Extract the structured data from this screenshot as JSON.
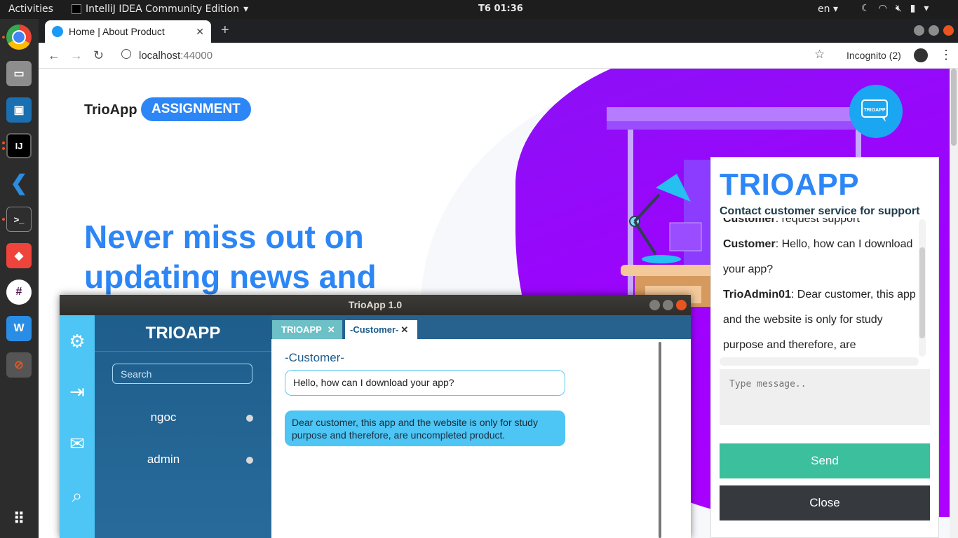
{
  "topbar": {
    "activities": "Activities",
    "app_menu": "IntelliJ IDEA Community Edition",
    "clock": "T6 01:36",
    "lang": "en"
  },
  "dock": {
    "items": [
      "chrome-icon",
      "files-icon",
      "virtualbox-icon",
      "intellij-icon",
      "vscode-icon",
      "terminal-icon",
      "anydesk-icon",
      "slack-icon",
      "wps-icon",
      "unknown-app-icon",
      "show-apps-icon"
    ]
  },
  "browser": {
    "tab_title": "Home | About Product",
    "url_host": "localhost",
    "url_port": ":44000",
    "incognito": "Incognito (2)"
  },
  "page": {
    "logo": "TrioApp",
    "badge": "ASSIGNMENT",
    "headline": "Never miss out on updating news and",
    "fab_label": "TRIOAPP"
  },
  "widget": {
    "title": "TRIOAPP",
    "subtitle": "Contact customer service for support",
    "messages": [
      {
        "sender": "Customer",
        "text": ": request support"
      },
      {
        "sender": "Customer",
        "text": ": Hello, how can I download your app?"
      },
      {
        "sender": "TrioAdmin01",
        "text": ": Dear customer, this app and the website is only for study purpose and therefore, are"
      }
    ],
    "input_placeholder": "Type message..",
    "send_label": "Send",
    "close_label": "Close"
  },
  "app_window": {
    "title": "TrioApp 1.0",
    "brand": "TRIOAPP",
    "search_placeholder": "Search",
    "users": [
      {
        "name": "ngoc"
      },
      {
        "name": "admin"
      }
    ],
    "tabs": [
      {
        "label": "TRIOAPP"
      },
      {
        "label": "-Customer-"
      }
    ],
    "chat_name": "-Customer-",
    "message_out": "Hello, how can I download your app?",
    "message_in": "Dear customer, this app and the website is only for study purpose and therefore, are uncompleted product."
  },
  "colors": {
    "accent_blue": "#2d86f5",
    "purple": "#a100ff",
    "send_green": "#3bbf9d",
    "app_sidebar": "#1e5d8c",
    "app_rail": "#4dc5f5"
  }
}
